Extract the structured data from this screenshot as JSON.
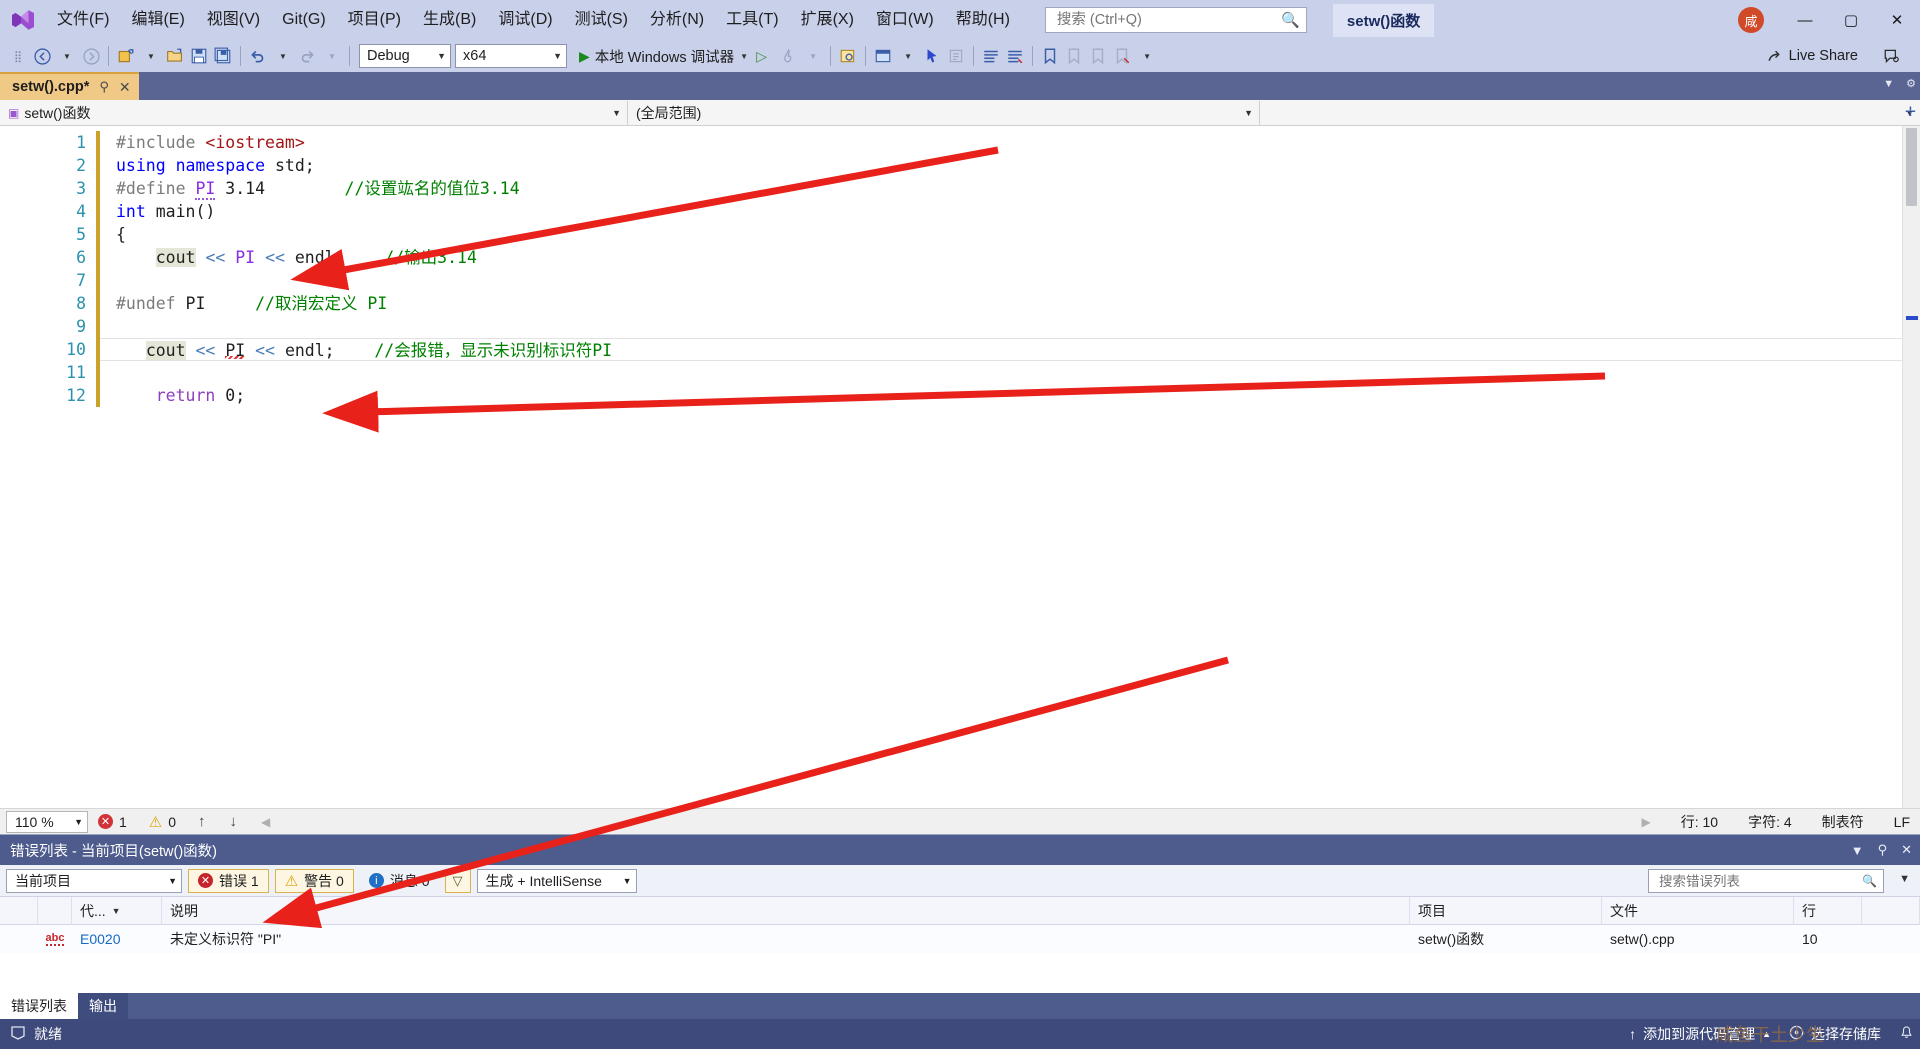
{
  "window": {
    "solution_name": "setw()函数",
    "avatar_initial": "咸",
    "minimize": "—",
    "maximize": "▢",
    "close": "✕"
  },
  "menu": {
    "items": [
      {
        "label": "文件(F)"
      },
      {
        "label": "编辑(E)"
      },
      {
        "label": "视图(V)"
      },
      {
        "label": "Git(G)"
      },
      {
        "label": "项目(P)"
      },
      {
        "label": "生成(B)"
      },
      {
        "label": "调试(D)"
      },
      {
        "label": "测试(S)"
      },
      {
        "label": "分析(N)"
      },
      {
        "label": "工具(T)"
      },
      {
        "label": "扩展(X)"
      },
      {
        "label": "窗口(W)"
      },
      {
        "label": "帮助(H)"
      }
    ]
  },
  "search": {
    "placeholder": "搜索 (Ctrl+Q)",
    "value": "",
    "icon": "search-icon"
  },
  "toolbar": {
    "config": "Debug",
    "platform": "x64",
    "run_label": "本地 Windows 调试器",
    "live_share": "Live Share"
  },
  "document_tab": {
    "title": "setw().cpp*",
    "pin": "⚲",
    "close": "✕"
  },
  "navbar": {
    "scope_left": "setw()函数",
    "scope_mid": "(全局范围)",
    "scope_right": ""
  },
  "editor": {
    "line_numbers": [
      "1",
      "2",
      "3",
      "4",
      "5",
      "6",
      "7",
      "8",
      "9",
      "10",
      "11",
      "12"
    ],
    "lines": [
      {
        "n": 1,
        "text": "#include <iostream>"
      },
      {
        "n": 2,
        "text": "using namespace std;"
      },
      {
        "n": 3,
        "text": "#define PI 3.14        //设置竑名的值位3.14"
      },
      {
        "n": 4,
        "text": "int main()"
      },
      {
        "n": 5,
        "text": "{"
      },
      {
        "n": 6,
        "text": "    cout << PI << endl;    //输出3.14"
      },
      {
        "n": 7,
        "text": ""
      },
      {
        "n": 8,
        "text": "#undef PI     //取消宏定义 PI"
      },
      {
        "n": 9,
        "text": ""
      },
      {
        "n": 10,
        "text": "    cout << PI << endl;    //会报错，显示未识别标识符PI"
      },
      {
        "n": 11,
        "text": ""
      },
      {
        "n": 12,
        "text": "    return 0;"
      }
    ],
    "tok": {
      "l1_pre": "#include",
      "l1_inc": "<iostream>",
      "l2_using": "using",
      "l2_ns": "namespace",
      "l2_std": " std;",
      "l3_pre": "#define",
      "l3_macro": "PI",
      "l3_num": "3.14",
      "l3_comment": "//设置竑名的值位3.14",
      "l4_int": "int",
      "l4_main": " main()",
      "l5_brace": "{",
      "l6_cout": "cout",
      "l6_op1": "<<",
      "l6_pi": "PI",
      "l6_op2": "<<",
      "l6_endl": "endl;",
      "l6_comment": "//输出3.14",
      "l8_pre": "#undef",
      "l8_pi": "PI",
      "l8_comment": "//取消宏定义 PI",
      "l10_cout": "cout",
      "l10_op1": "<<",
      "l10_pi": "PI",
      "l10_op2": "<<",
      "l10_endl": "endl;",
      "l10_comment": "//会报错，显示未识别标识符PI",
      "l12_return": "return",
      "l12_zero": " 0;"
    }
  },
  "editor_status": {
    "zoom": "110 %",
    "error_count": "1",
    "warning_count": "0",
    "line_label": "行: 10",
    "char_label": "字符: 4",
    "tab_label": "制表符",
    "eol_label": "LF"
  },
  "error_panel": {
    "title": "错误列表 - 当前项目(setw()函数)",
    "scope_filter": "当前项目",
    "errors_label": "错误 1",
    "warnings_label": "警告 0",
    "messages_label": "消息 0",
    "build_filter": "生成 + IntelliSense",
    "search_placeholder": "搜索错误列表",
    "columns": [
      {
        "key": "gutter",
        "label": ""
      },
      {
        "key": "icon",
        "label": ""
      },
      {
        "key": "code",
        "label": "代..."
      },
      {
        "key": "description",
        "label": "说明"
      },
      {
        "key": "project",
        "label": "项目"
      },
      {
        "key": "file",
        "label": "文件"
      },
      {
        "key": "line",
        "label": "行"
      },
      {
        "key": "suppress",
        "label": ""
      }
    ],
    "rows": [
      {
        "icon": "abc",
        "code": "E0020",
        "description": "未定义标识符 \"PI\"",
        "project": "setw()函数",
        "file": "setw().cpp",
        "line": "10",
        "suppress": ""
      }
    ],
    "tabs": [
      {
        "label": "错误列表",
        "active": true
      },
      {
        "label": "输出",
        "active": false
      }
    ]
  },
  "statusbar": {
    "ready": "就绪",
    "source_control": "添加到源代码管理",
    "repo": "选择存储库"
  },
  "watermark": {
    "text": "咸鱼干土少生"
  },
  "colors": {
    "titlebar": "#c8d0ea",
    "accent_tab": "#f0c987",
    "panel_header": "#4e5b8d",
    "statusbar": "#3e4a7b",
    "annotation_red": "#e8221b",
    "comment_green": "#008000",
    "macro_purple": "#8a2be2",
    "keyword_blue": "#0000ff",
    "string_red": "#a31515"
  }
}
